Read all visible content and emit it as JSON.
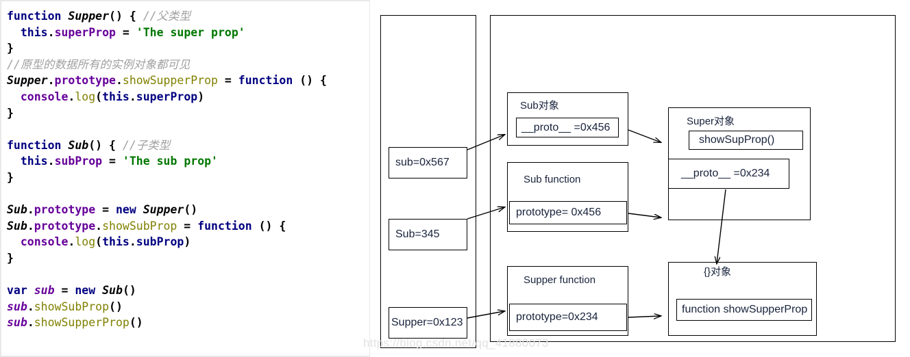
{
  "code_panel": {
    "lines": [
      [
        {
          "t": "function ",
          "c": "kw"
        },
        {
          "t": "Supper",
          "c": "fn"
        },
        {
          "t": "() { ",
          "c": "pl"
        },
        {
          "t": "//父类型",
          "c": "cmt"
        }
      ],
      [
        {
          "t": "  ",
          "c": "pl"
        },
        {
          "t": "this",
          "c": "this"
        },
        {
          "t": ".",
          "c": "pl"
        },
        {
          "t": "superProp",
          "c": "prop"
        },
        {
          "t": " = ",
          "c": "op"
        },
        {
          "t": "'The super prop'",
          "c": "str"
        }
      ],
      [
        {
          "t": "}",
          "c": "pl"
        }
      ],
      [
        {
          "t": "//原型的数据所有的实例对象都可见",
          "c": "cmt"
        }
      ],
      [
        {
          "t": "Supper",
          "c": "fn"
        },
        {
          "t": ".",
          "c": "pl"
        },
        {
          "t": "prototype",
          "c": "prop"
        },
        {
          "t": ".",
          "c": "pl"
        },
        {
          "t": "showSupperProp",
          "c": "mth"
        },
        {
          "t": " = ",
          "c": "op"
        },
        {
          "t": "function",
          "c": "kw"
        },
        {
          "t": " () {",
          "c": "pl"
        }
      ],
      [
        {
          "t": "  ",
          "c": "pl"
        },
        {
          "t": "console",
          "c": "prop"
        },
        {
          "t": ".",
          "c": "pl"
        },
        {
          "t": "log",
          "c": "mth"
        },
        {
          "t": "(",
          "c": "pl"
        },
        {
          "t": "this",
          "c": "this"
        },
        {
          "t": ".",
          "c": "pl"
        },
        {
          "t": "superProp",
          "c": "this"
        },
        {
          "t": ")",
          "c": "pl"
        }
      ],
      [
        {
          "t": "}",
          "c": "pl"
        }
      ],
      [],
      [
        {
          "t": "function ",
          "c": "kw"
        },
        {
          "t": "Sub",
          "c": "fn"
        },
        {
          "t": "() { ",
          "c": "pl"
        },
        {
          "t": "//子类型",
          "c": "cmt"
        }
      ],
      [
        {
          "t": "  ",
          "c": "pl"
        },
        {
          "t": "this",
          "c": "this"
        },
        {
          "t": ".",
          "c": "pl"
        },
        {
          "t": "subProp",
          "c": "prop"
        },
        {
          "t": " = ",
          "c": "op"
        },
        {
          "t": "'The sub prop'",
          "c": "str"
        }
      ],
      [
        {
          "t": "}",
          "c": "pl"
        }
      ],
      [],
      [
        {
          "t": "Sub",
          "c": "fn"
        },
        {
          "t": ".",
          "c": "pl"
        },
        {
          "t": "prototype",
          "c": "prop"
        },
        {
          "t": " = ",
          "c": "op"
        },
        {
          "t": "new ",
          "c": "kw"
        },
        {
          "t": "Supper",
          "c": "fn"
        },
        {
          "t": "()",
          "c": "pl"
        }
      ],
      [
        {
          "t": "Sub",
          "c": "fn"
        },
        {
          "t": ".",
          "c": "pl"
        },
        {
          "t": "prototype",
          "c": "prop"
        },
        {
          "t": ".",
          "c": "pl"
        },
        {
          "t": "showSubProp",
          "c": "mth"
        },
        {
          "t": " = ",
          "c": "op"
        },
        {
          "t": "function",
          "c": "kw"
        },
        {
          "t": " () {",
          "c": "pl"
        }
      ],
      [
        {
          "t": "  ",
          "c": "pl"
        },
        {
          "t": "console",
          "c": "prop"
        },
        {
          "t": ".",
          "c": "pl"
        },
        {
          "t": "log",
          "c": "mth"
        },
        {
          "t": "(",
          "c": "pl"
        },
        {
          "t": "this",
          "c": "this"
        },
        {
          "t": ".",
          "c": "pl"
        },
        {
          "t": "subProp",
          "c": "this"
        },
        {
          "t": ")",
          "c": "pl"
        }
      ],
      [
        {
          "t": "}",
          "c": "pl"
        }
      ],
      [],
      [
        {
          "t": "var ",
          "c": "kw"
        },
        {
          "t": "sub",
          "c": "vr"
        },
        {
          "t": " = ",
          "c": "op"
        },
        {
          "t": "new ",
          "c": "kw"
        },
        {
          "t": "Sub",
          "c": "fn"
        },
        {
          "t": "()",
          "c": "pl"
        }
      ],
      [
        {
          "t": "sub",
          "c": "vr"
        },
        {
          "t": ".",
          "c": "pl"
        },
        {
          "t": "showSubProp",
          "c": "mth"
        },
        {
          "t": "()",
          "c": "pl"
        }
      ],
      [
        {
          "t": "sub",
          "c": "vr"
        },
        {
          "t": ".",
          "c": "pl"
        },
        {
          "t": "showSupperProp",
          "c": "mth"
        },
        {
          "t": "()",
          "c": "pl"
        }
      ]
    ]
  },
  "diagram": {
    "stack": {
      "cells": [
        {
          "label": "sub=0x567"
        },
        {
          "label": "Sub=345"
        },
        {
          "label": "Supper=0x123"
        }
      ]
    },
    "heap": {
      "boxes": [
        {
          "title": "Sub对象",
          "slots": [
            {
              "label": "__proto__ =0x456"
            }
          ]
        },
        {
          "title": "Sub function",
          "slots": [
            {
              "label": "prototype= 0x456"
            }
          ]
        },
        {
          "title": "Supper function",
          "slots": [
            {
              "label": "prototype=0x234"
            }
          ]
        },
        {
          "title": "Super对象",
          "slots": [
            {
              "label": "showSupProp()"
            },
            {
              "label": "__proto__ =0x234"
            }
          ]
        },
        {
          "title": "{}对象",
          "slots": [
            {
              "label": "function showSupperProp"
            }
          ]
        }
      ]
    }
  },
  "watermark": {
    "text": "https://blog.csdn.net/qq_41880073"
  },
  "colors": {
    "box_border": "#000000",
    "diagram_text": "#17223b",
    "code_keyword": "#000080",
    "code_string": "#007700",
    "code_comment": "#a0a0a0",
    "code_method": "#808000",
    "code_var": "#660099",
    "watermark": "#e2e2e2"
  }
}
